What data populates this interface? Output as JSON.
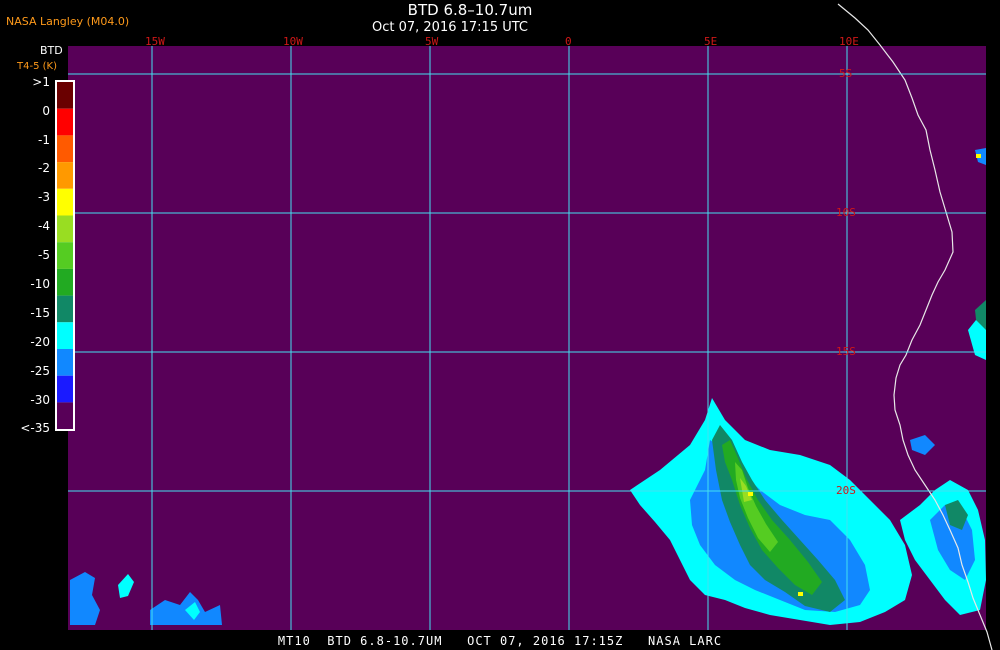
{
  "header": {
    "source": "NASA Langley (M04.0)",
    "title": "BTD 6.8–10.7um",
    "timestamp": "Oct 07, 2016 17:15 UTC"
  },
  "legend": {
    "title": "BTD",
    "subtitle": "T4-5 (K)",
    "entries": [
      {
        "label": ">1",
        "color": "#6a0000"
      },
      {
        "label": "0",
        "color": "#ff0000"
      },
      {
        "label": "-1",
        "color": "#ff5a00"
      },
      {
        "label": "-2",
        "color": "#ff9900"
      },
      {
        "label": "-3",
        "color": "#ffff00"
      },
      {
        "label": "-4",
        "color": "#99dd22"
      },
      {
        "label": "-5",
        "color": "#55cc22"
      },
      {
        "label": "-10",
        "color": "#22aa22"
      },
      {
        "label": "-15",
        "color": "#118866"
      },
      {
        "label": "-20",
        "color": "#00ffff"
      },
      {
        "label": "-25",
        "color": "#1188ff"
      },
      {
        "label": "-30",
        "color": "#1a1aff"
      },
      {
        "label": "<-35",
        "color": "#580058"
      }
    ]
  },
  "map": {
    "background_color": "#580058",
    "grid_color": "#44e0f0",
    "lon_labels": [
      "15W",
      "10W",
      "5W",
      "0",
      "5E",
      "10E"
    ],
    "lat_labels": [
      "5S",
      "10S",
      "15S",
      "20S"
    ]
  },
  "footer": {
    "caption": "MT10  BTD 6.8-10.7UM   OCT 07, 2016 17:15Z   NASA LARC"
  }
}
